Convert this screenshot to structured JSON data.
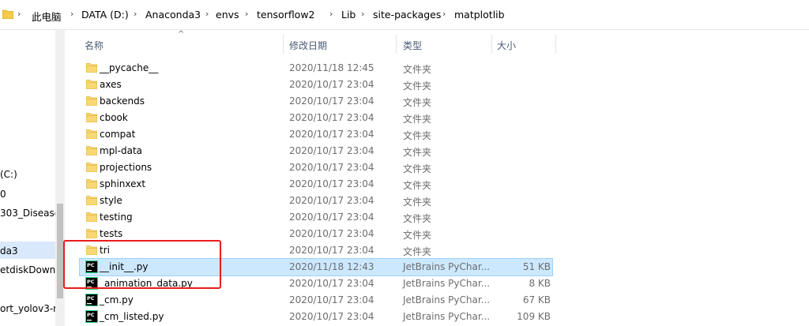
{
  "address_bar": {
    "crumbs": [
      "此电脑",
      "DATA (D:)",
      "Anaconda3",
      "envs",
      "tensorflow2",
      "Lib",
      "site-packages",
      "matplotlib"
    ]
  },
  "nav_pane": {
    "items": [
      "(C:)",
      "0",
      "303_Disease",
      "da3",
      "etdiskDownl",
      "ort_yolov3-m"
    ]
  },
  "columns": {
    "name": "名称",
    "date": "修改日期",
    "type": "类型",
    "size": "大小"
  },
  "files": [
    {
      "name": "__pycache__",
      "date": "2020/11/18 12:45",
      "type": "文件夹",
      "size": "",
      "kind": "folder-icon"
    },
    {
      "name": "axes",
      "date": "2020/10/17 23:04",
      "type": "文件夹",
      "size": "",
      "kind": "folder-icon"
    },
    {
      "name": "backends",
      "date": "2020/10/17 23:04",
      "type": "文件夹",
      "size": "",
      "kind": "folder-icon"
    },
    {
      "name": "cbook",
      "date": "2020/10/17 23:04",
      "type": "文件夹",
      "size": "",
      "kind": "folder-icon"
    },
    {
      "name": "compat",
      "date": "2020/10/17 23:04",
      "type": "文件夹",
      "size": "",
      "kind": "folder-icon"
    },
    {
      "name": "mpl-data",
      "date": "2020/10/17 23:04",
      "type": "文件夹",
      "size": "",
      "kind": "folder-icon"
    },
    {
      "name": "projections",
      "date": "2020/10/17 23:04",
      "type": "文件夹",
      "size": "",
      "kind": "folder-icon"
    },
    {
      "name": "sphinxext",
      "date": "2020/10/17 23:04",
      "type": "文件夹",
      "size": "",
      "kind": "folder-icon"
    },
    {
      "name": "style",
      "date": "2020/10/17 23:04",
      "type": "文件夹",
      "size": "",
      "kind": "folder-icon"
    },
    {
      "name": "testing",
      "date": "2020/10/17 23:04",
      "type": "文件夹",
      "size": "",
      "kind": "folder-icon"
    },
    {
      "name": "tests",
      "date": "2020/10/17 23:04",
      "type": "文件夹",
      "size": "",
      "kind": "folder-icon"
    },
    {
      "name": "tri",
      "date": "2020/10/17 23:04",
      "type": "文件夹",
      "size": "",
      "kind": "folder-icon"
    },
    {
      "name": "__init__.py",
      "date": "2020/11/18 12:43",
      "type": "JetBrains PyChar...",
      "size": "51 KB",
      "kind": "pycharm-file-icon",
      "selected": true
    },
    {
      "name": "_animation_data.py",
      "date": "2020/10/17 23:04",
      "type": "JetBrains PyChar...",
      "size": "8 KB",
      "kind": "pycharm-file-icon"
    },
    {
      "name": "_cm.py",
      "date": "2020/10/17 23:04",
      "type": "JetBrains PyChar...",
      "size": "67 KB",
      "kind": "pycharm-file-icon"
    },
    {
      "name": "_cm_listed.py",
      "date": "2020/10/17 23:04",
      "type": "JetBrains PyChar...",
      "size": "109 KB",
      "kind": "pycharm-file-icon"
    }
  ],
  "colors": {
    "selected_row": "#cce8ff",
    "annotation_box": "#e81c1c",
    "folder": "#f5c94a"
  }
}
